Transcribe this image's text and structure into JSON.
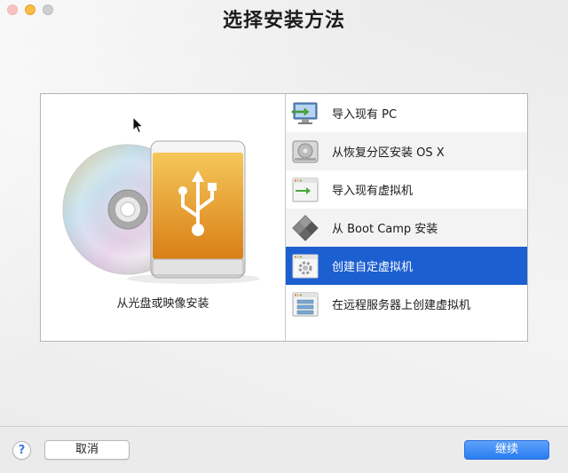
{
  "window": {
    "title": "选择安装方法"
  },
  "left_pane": {
    "caption": "从光盘或映像安装"
  },
  "install_methods": [
    {
      "label": "导入现有 PC",
      "icon": "monitor-import-icon",
      "selected": false
    },
    {
      "label": "从恢复分区安装 OS X",
      "icon": "hard-drive-icon",
      "selected": false
    },
    {
      "label": "导入现有虚拟机",
      "icon": "vm-import-icon",
      "selected": false
    },
    {
      "label": "从 Boot Camp 安装",
      "icon": "boot-camp-icon",
      "selected": false
    },
    {
      "label": "创建自定虚拟机",
      "icon": "custom-vm-gear-icon",
      "selected": true
    },
    {
      "label": "在远程服务器上创建虚拟机",
      "icon": "remote-server-icon",
      "selected": false
    }
  ],
  "footer": {
    "help_label": "?",
    "cancel_label": "取消",
    "continue_label": "继续"
  },
  "colors": {
    "selection": "#1c5fd0",
    "primary_button": "#2a7cf1",
    "usb_drive": "#e8a032"
  }
}
